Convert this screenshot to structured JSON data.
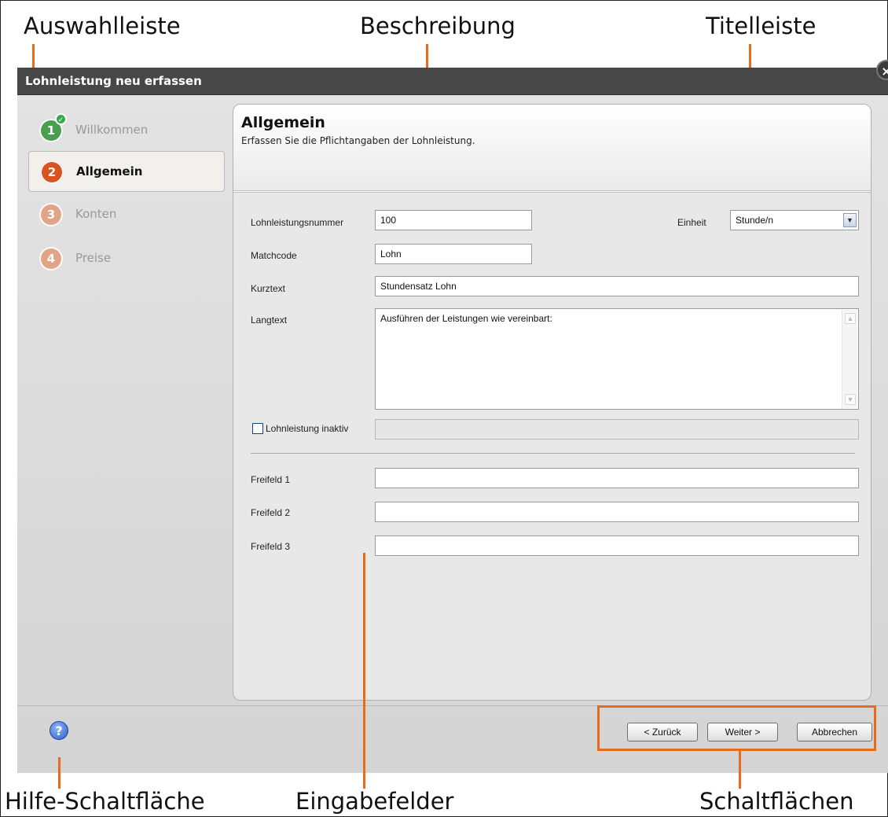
{
  "annotations": {
    "auswahlleiste": "Auswahlleiste",
    "beschreibung": "Beschreibung",
    "titelleiste": "Titelleiste",
    "hilfe": "Hilfe-Schaltfläche",
    "eingabefelder": "Eingabefelder",
    "schaltflaechen": "Schaltflächen"
  },
  "window": {
    "title": "Lohnleistung neu erfassen",
    "close_glyph": "×"
  },
  "sidebar": {
    "items": [
      {
        "number": "1",
        "label": "Willkommen",
        "state": "done",
        "color": "#4a9e4f"
      },
      {
        "number": "2",
        "label": "Allgemein",
        "state": "active",
        "color": "#d9531e"
      },
      {
        "number": "3",
        "label": "Konten",
        "state": "pending",
        "color": "#e0a486"
      },
      {
        "number": "4",
        "label": "Preise",
        "state": "pending",
        "color": "#e0a486"
      }
    ],
    "check_glyph": "✓"
  },
  "panel": {
    "title": "Allgemein",
    "subtitle": "Erfassen Sie die Pflichtangaben der Lohnleistung."
  },
  "form": {
    "lohnleistungsnummer": {
      "label": "Lohnleistungsnummer",
      "value": "100"
    },
    "einheit": {
      "label": "Einheit",
      "value": "Stunde/n",
      "arrow": "▼"
    },
    "matchcode": {
      "label": "Matchcode",
      "value": "Lohn"
    },
    "kurztext": {
      "label": "Kurztext",
      "value": "Stundensatz Lohn"
    },
    "langtext": {
      "label": "Langtext",
      "value": "Ausführen der Leistungen wie vereinbart:",
      "scroll_up": "▲",
      "scroll_down": "▼"
    },
    "inaktiv": {
      "label": "Lohnleistung inaktiv",
      "checked": false,
      "value": ""
    },
    "freifeld1": {
      "label": "Freifeld 1",
      "value": ""
    },
    "freifeld2": {
      "label": "Freifeld 2",
      "value": ""
    },
    "freifeld3": {
      "label": "Freifeld 3",
      "value": ""
    }
  },
  "footer": {
    "help_glyph": "?",
    "back_label": "< Zurück",
    "next_label": "Weiter >",
    "cancel_label": "Abbrechen"
  },
  "colors": {
    "accent": "#e86a1c",
    "titlebar": "#474747"
  }
}
